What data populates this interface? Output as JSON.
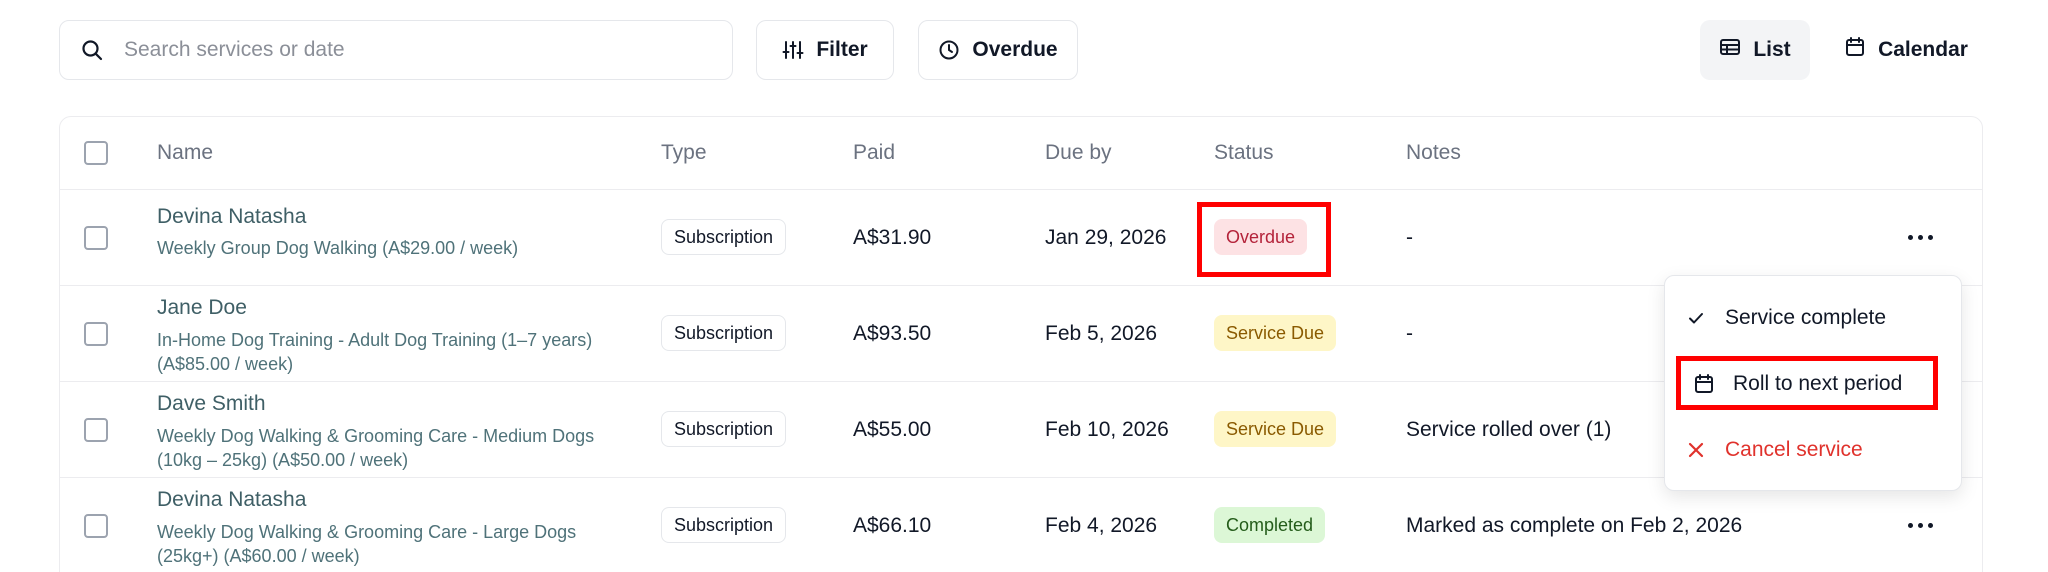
{
  "toolbar": {
    "search_placeholder": "Search services or date",
    "filter_label": "Filter",
    "overdue_label": "Overdue",
    "list_label": "List",
    "calendar_label": "Calendar"
  },
  "table": {
    "columns": [
      "Name",
      "Type",
      "Paid",
      "Due by",
      "Status",
      "Notes"
    ],
    "rows": [
      {
        "name": "Devina Natasha",
        "service": "Weekly Group Dog Walking (A$29.00 / week)",
        "type": "Subscription",
        "paid": "A$31.90",
        "due": "Jan 29, 2026",
        "status": "Overdue",
        "notes": "-"
      },
      {
        "name": "Jane Doe",
        "service": "In-Home Dog Training - Adult Dog Training (1–7 years) (A$85.00 / week)",
        "type": "Subscription",
        "paid": "A$93.50",
        "due": "Feb 5, 2026",
        "status": "Service Due",
        "notes": "-"
      },
      {
        "name": "Dave Smith",
        "service": "Weekly Dog Walking & Grooming Care - Medium Dogs (10kg – 25kg) (A$50.00 / week)",
        "type": "Subscription",
        "paid": "A$55.00",
        "due": "Feb 10, 2026",
        "status": "Service Due",
        "notes": "Service rolled over (1)"
      },
      {
        "name": "Devina Natasha",
        "service": "Weekly Dog Walking & Grooming Care - Large Dogs (25kg+) (A$60.00 / week)",
        "type": "Subscription",
        "paid": "A$66.10",
        "due": "Feb 4, 2026",
        "status": "Completed",
        "notes": "Marked as complete on Feb 2, 2026"
      }
    ]
  },
  "menu": {
    "complete": "Service complete",
    "roll": "Roll to next period",
    "cancel": "Cancel service"
  },
  "colors": {
    "highlight": "#ff0000",
    "overdue_bg": "#fde2e4",
    "service_due_bg": "#fef6c7",
    "completed_bg": "#dcf7d6",
    "danger": "#e0322c"
  }
}
